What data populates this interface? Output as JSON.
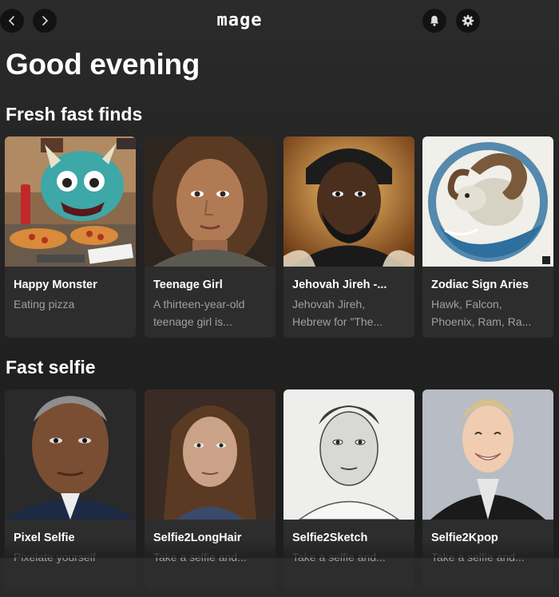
{
  "app": {
    "logo_text": "mage"
  },
  "greeting": "Good evening",
  "sections": [
    {
      "title": "Fresh fast finds",
      "cards": [
        {
          "title": "Happy Monster",
          "desc": "Eating pizza"
        },
        {
          "title": "Teenage Girl",
          "desc": "A thirteen-year-old teenage girl is..."
        },
        {
          "title": "Jehovah Jireh -...",
          "desc": "Jehovah Jireh, Hebrew for \"The..."
        },
        {
          "title": "Zodiac Sign Aries",
          "desc": "Hawk, Falcon, Phoenix, Ram, Ra..."
        }
      ]
    },
    {
      "title": "Fast selfie",
      "cards": [
        {
          "title": "Pixel Selfie",
          "desc": "Pixelate yourself"
        },
        {
          "title": "Selfie2LongHair",
          "desc": "Take a selfie and..."
        },
        {
          "title": "Selfie2Sketch",
          "desc": "Take a selfie and..."
        },
        {
          "title": "Selfie2Kpop",
          "desc": "Take a selfie and..."
        }
      ]
    }
  ],
  "icons": {
    "back": "chevron-left-icon",
    "forward": "chevron-right-icon",
    "notifications": "bell-icon",
    "settings": "gear-icon"
  },
  "colors": {
    "background": "#222222",
    "card": "#2d2d2d",
    "muted_text": "#a0a0a0"
  }
}
